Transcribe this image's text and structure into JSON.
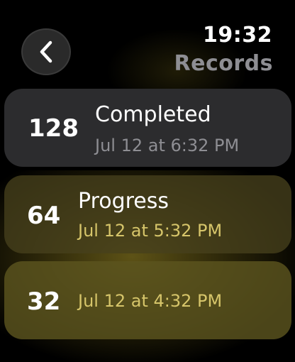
{
  "header": {
    "time": "19:32",
    "title": "Records"
  },
  "icons": {
    "back": "chevron-left-icon"
  },
  "colors": {
    "card_background": "#2c2c2e",
    "secondary_text": "#8e8e93",
    "highlight_text": "#d6c56a"
  },
  "records": [
    {
      "value": "128",
      "label": "Completed",
      "date": "Jul 12 at 6:32 PM"
    },
    {
      "value": "64",
      "label": "Progress",
      "date": "Jul 12 at 5:32 PM"
    },
    {
      "value": "32",
      "label": "",
      "date": "Jul 12 at 4:32 PM"
    }
  ]
}
